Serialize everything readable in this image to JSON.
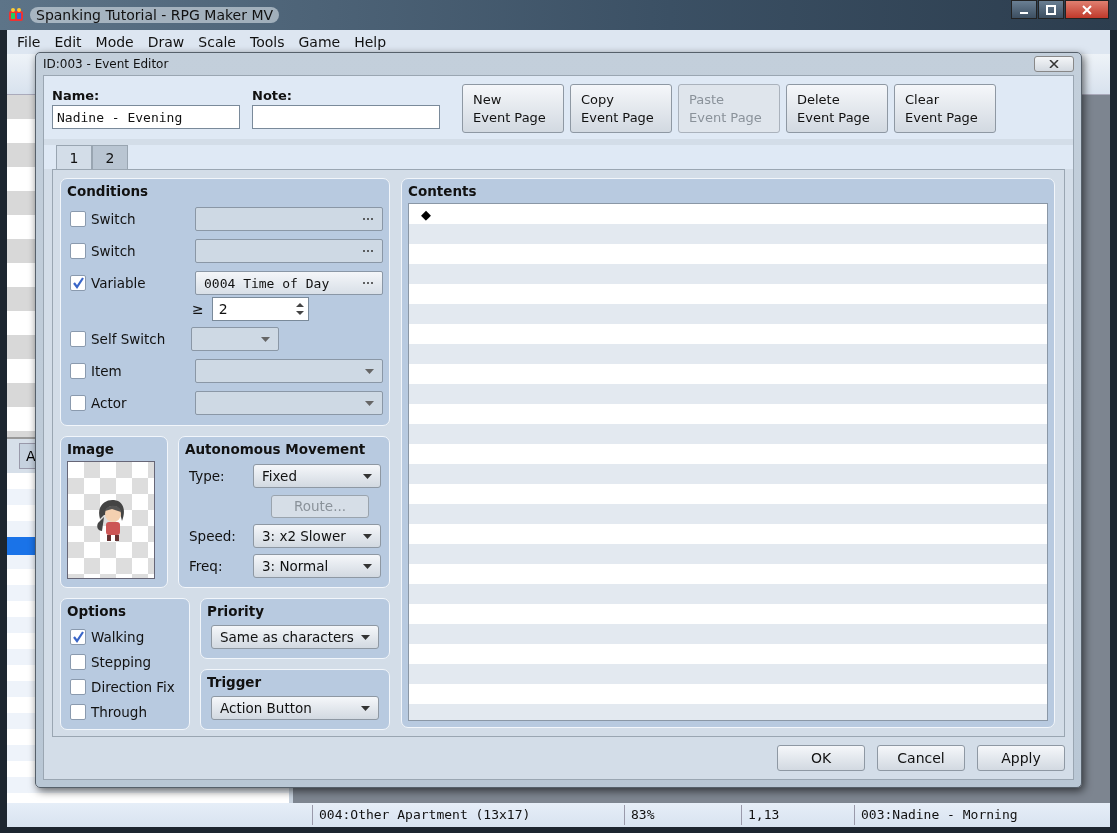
{
  "window": {
    "title": "Spanking Tutorial - RPG Maker MV"
  },
  "menu": [
    "File",
    "Edit",
    "Mode",
    "Draw",
    "Scale",
    "Tools",
    "Game",
    "Help"
  ],
  "left_panel": {
    "tabs": [
      "A"
    ]
  },
  "status_bar": [
    "004:Other Apartment (13x17)",
    "83%",
    "1,13",
    "003:Nadine - Morning"
  ],
  "dialog": {
    "title": "ID:003 - Event Editor",
    "name_label": "Name:",
    "name": "Nadine - Evening",
    "note_label": "Note:",
    "page_buttons": [
      {
        "lines": [
          "New",
          "Event Page"
        ],
        "disabled": false
      },
      {
        "lines": [
          "Copy",
          "Event Page"
        ],
        "disabled": false
      },
      {
        "lines": [
          "Paste",
          "Event Page"
        ],
        "disabled": true
      },
      {
        "lines": [
          "Delete",
          "Event Page"
        ],
        "disabled": false
      },
      {
        "lines": [
          "Clear",
          "Event Page"
        ],
        "disabled": false
      }
    ],
    "tabs": [
      {
        "label": "1",
        "selected": true
      },
      {
        "label": "2",
        "selected": false
      }
    ],
    "conditions": {
      "title": "Conditions",
      "rows": [
        {
          "kind": "picker",
          "label": "Switch",
          "checked": false
        },
        {
          "kind": "picker",
          "label": "Switch",
          "checked": false
        },
        {
          "kind": "picker",
          "label": "Variable",
          "checked": true,
          "value": "0004 Time of Day",
          "compare": "≥",
          "number": "2"
        },
        {
          "kind": "short-dropdown",
          "label": "Self Switch",
          "checked": false
        },
        {
          "kind": "dropdown",
          "label": "Item",
          "checked": false
        },
        {
          "kind": "dropdown",
          "label": "Actor",
          "checked": false
        }
      ]
    },
    "image": {
      "title": "Image"
    },
    "movement": {
      "title": "Autonomous Movement",
      "type_label": "Type:",
      "type": "Fixed",
      "route": "Route...",
      "route_disabled": true,
      "speed_label": "Speed:",
      "speed": "3: x2 Slower",
      "freq_label": "Freq:",
      "freq": "3: Normal"
    },
    "options": {
      "title": "Options",
      "items": [
        {
          "label": "Walking",
          "checked": true
        },
        {
          "label": "Stepping",
          "checked": false
        },
        {
          "label": "Direction Fix",
          "checked": false
        },
        {
          "label": "Through",
          "checked": false
        }
      ]
    },
    "priority": {
      "title": "Priority",
      "value": "Same as characters"
    },
    "trigger": {
      "title": "Trigger",
      "value": "Action Button"
    },
    "contents": {
      "title": "Contents",
      "commands": [
        "◆"
      ]
    },
    "buttons": [
      "OK",
      "Cancel",
      "Apply"
    ]
  }
}
